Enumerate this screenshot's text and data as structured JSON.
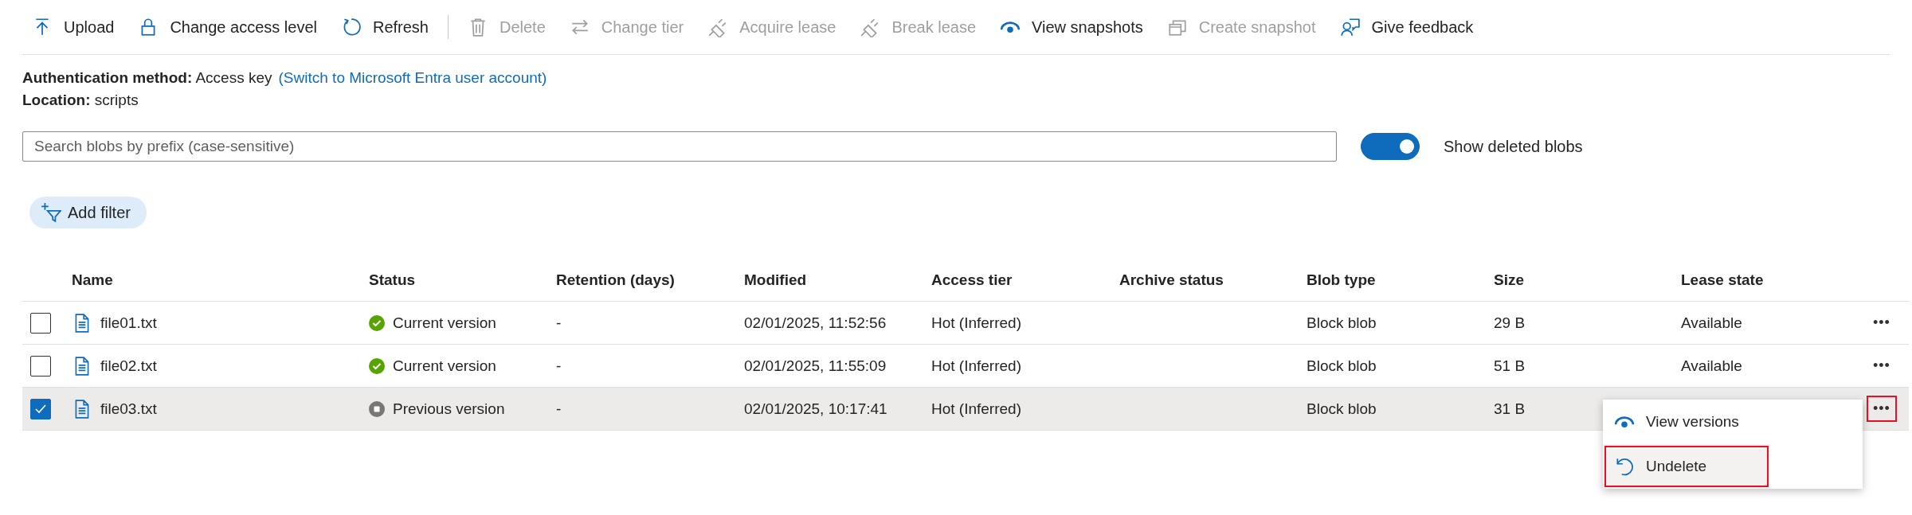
{
  "toolbar": [
    {
      "label": "Upload",
      "kind": "upload",
      "disabled": false
    },
    {
      "label": "Change access level",
      "kind": "lock",
      "disabled": false
    },
    {
      "label": "Refresh",
      "kind": "refresh",
      "disabled": false
    },
    {
      "kind": "separator"
    },
    {
      "label": "Delete",
      "kind": "trash",
      "disabled": true
    },
    {
      "label": "Change tier",
      "kind": "swap",
      "disabled": true
    },
    {
      "label": "Acquire lease",
      "kind": "plug",
      "disabled": true
    },
    {
      "label": "Break lease",
      "kind": "plug",
      "disabled": true
    },
    {
      "label": "View snapshots",
      "kind": "eye",
      "disabled": false
    },
    {
      "label": "Create snapshot",
      "kind": "copy",
      "disabled": true
    },
    {
      "label": "Give feedback",
      "kind": "feedback",
      "disabled": false
    }
  ],
  "info": [
    {
      "label": "Authentication method:",
      "value": "Access key",
      "link": "(Switch to Microsoft Entra user account)"
    },
    {
      "label": "Location:",
      "value": "scripts"
    }
  ],
  "search": {
    "placeholder": "Search blobs by prefix (case-sensitive)"
  },
  "toggle": {
    "label": "Show deleted blobs",
    "on": true
  },
  "filter_button": "Add filter",
  "table": {
    "columns": [
      "Name",
      "Status",
      "Retention (days)",
      "Modified",
      "Access tier",
      "Archive status",
      "Blob type",
      "Size",
      "Lease state"
    ],
    "rows": [
      {
        "checked": false,
        "name": "file01.txt",
        "status": "Current version",
        "kind": "current",
        "retention": "-",
        "modified": "02/01/2025, 11:52:56",
        "access_tier": "Hot (Inferred)",
        "blob_type": "Block blob",
        "size": "29 B",
        "lease_state": "Available",
        "more": "•••",
        "highlighted": false
      },
      {
        "checked": false,
        "name": "file02.txt",
        "status": "Current version",
        "kind": "current",
        "retention": "-",
        "modified": "02/01/2025, 11:55:09",
        "access_tier": "Hot (Inferred)",
        "blob_type": "Block blob",
        "size": "51 B",
        "lease_state": "Available",
        "more": "•••",
        "highlighted": false
      },
      {
        "checked": true,
        "name": "file03.txt",
        "status": "Previous version",
        "kind": "previous",
        "retention": "-",
        "modified": "02/01/2025, 10:17:41",
        "access_tier": "Hot (Inferred)",
        "blob_type": "Block blob",
        "size": "31 B",
        "more": "•••",
        "highlighted": true
      }
    ]
  },
  "context_menu": {
    "items": [
      {
        "label": "View versions",
        "kind": "eye",
        "selected": false,
        "highlighted": false
      },
      {
        "label": "Undelete",
        "kind": "undo",
        "selected": true,
        "highlighted": true
      }
    ]
  }
}
